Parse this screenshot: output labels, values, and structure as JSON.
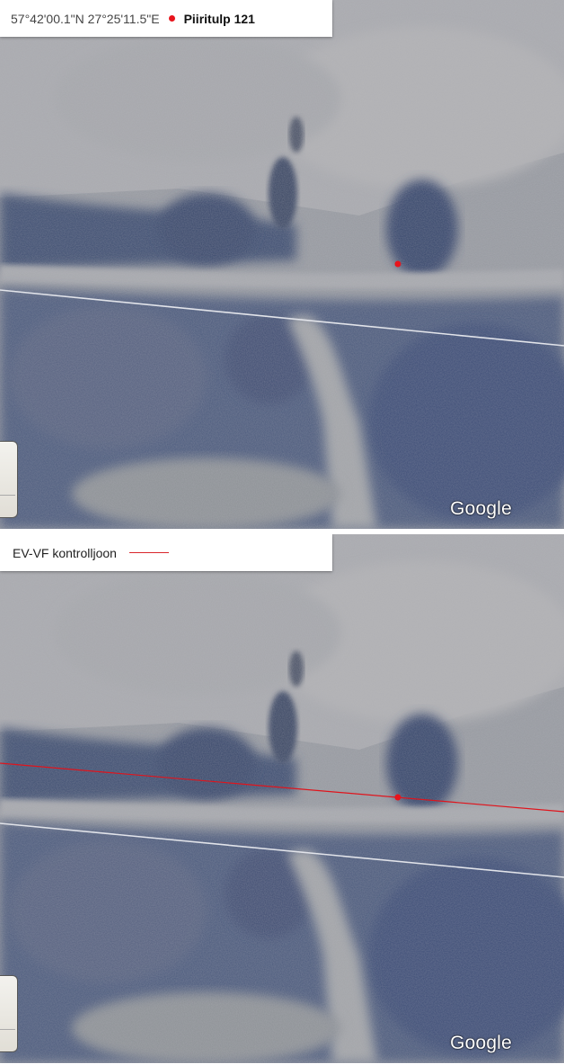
{
  "top_panel": {
    "coordinates": "57°42'00.1\"N 27°25'11.5\"E",
    "point_name": "Piiritulp 121",
    "point_color": "#e8141c",
    "attribution": "Google"
  },
  "bottom_panel": {
    "legend_label": "EV-VF kontrolljoon",
    "legend_line_color": "#d9262b",
    "attribution": "Google"
  },
  "colors": {
    "boundary_line": "#e2e4ea",
    "control_line": "#e0141c",
    "marker": "#e8141c"
  }
}
